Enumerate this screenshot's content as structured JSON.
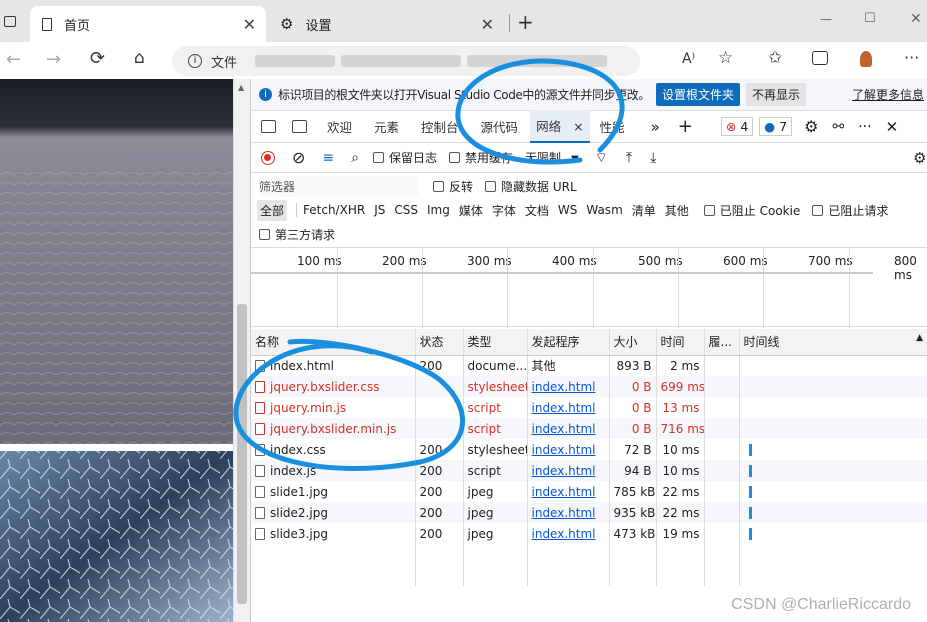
{
  "browser": {
    "tabs": [
      {
        "title": "首页",
        "close": "✕"
      },
      {
        "title": "设置",
        "close": "✕"
      }
    ],
    "new_tab": "+",
    "window_controls": [
      "—",
      "☐",
      "✕"
    ],
    "url_label": "文件",
    "read_aloud": "A⁾"
  },
  "devtools": {
    "infobar": {
      "text": "标识项目的根文件夹以打开Visual Studio Code中的源文件并同步更改。",
      "primary": "设置根文件夹",
      "secondary": "不再显示",
      "more": "了解更多信息"
    },
    "tabs": [
      "欢迎",
      "元素",
      "控制台",
      "源代码",
      "网络",
      "性能"
    ],
    "active_tab_close": "×",
    "error_count": "4",
    "info_count": "7",
    "toolbar": {
      "preserve_log": "保留日志",
      "disable_cache": "禁用缓存",
      "throttle": "无限制"
    },
    "filter": {
      "placeholder": "筛选器",
      "invert": "反转",
      "hide_data_urls": "隐藏数据 URL",
      "types": [
        "全部",
        "Fetch/XHR",
        "JS",
        "CSS",
        "Img",
        "媒体",
        "字体",
        "文档",
        "WS",
        "Wasm",
        "清单",
        "其他"
      ],
      "blocked_cookies": "已阻止 Cookie",
      "blocked_requests": "已阻止请求",
      "third_party": "第三方请求"
    },
    "timeline_ticks": [
      "100 ms",
      "200 ms",
      "300 ms",
      "400 ms",
      "500 ms",
      "600 ms",
      "700 ms",
      "800 ms"
    ],
    "columns": [
      "名称",
      "状态",
      "类型",
      "发起程序",
      "大小",
      "时间",
      "履...",
      "时间线"
    ],
    "rows": [
      {
        "name": "index.html",
        "status": "200",
        "type": "docume...",
        "initiator": "其他",
        "size": "893 B",
        "time": "2 ms",
        "error": false,
        "bar": false
      },
      {
        "name": "jquery.bxslider.css",
        "status": "",
        "type": "stylesheet",
        "initiator": "index.html",
        "size": "0 B",
        "time": "699 ms",
        "error": true,
        "bar": false
      },
      {
        "name": "jquery.min.js",
        "status": "",
        "type": "script",
        "initiator": "index.html",
        "size": "0 B",
        "time": "13 ms",
        "error": true,
        "bar": false
      },
      {
        "name": "jquery.bxslider.min.js",
        "status": "",
        "type": "script",
        "initiator": "index.html",
        "size": "0 B",
        "time": "716 ms",
        "error": true,
        "bar": false
      },
      {
        "name": "index.css",
        "status": "200",
        "type": "stylesheet",
        "initiator": "index.html",
        "size": "72 B",
        "time": "10 ms",
        "error": false,
        "bar": true
      },
      {
        "name": "index.js",
        "status": "200",
        "type": "script",
        "initiator": "index.html",
        "size": "94 B",
        "time": "10 ms",
        "error": false,
        "bar": true
      },
      {
        "name": "slide1.jpg",
        "status": "200",
        "type": "jpeg",
        "initiator": "index.html",
        "size": "785 kB",
        "time": "22 ms",
        "error": false,
        "bar": true
      },
      {
        "name": "slide2.jpg",
        "status": "200",
        "type": "jpeg",
        "initiator": "index.html",
        "size": "935 kB",
        "time": "22 ms",
        "error": false,
        "bar": true
      },
      {
        "name": "slide3.jpg",
        "status": "200",
        "type": "jpeg",
        "initiator": "index.html",
        "size": "473 kB",
        "time": "19 ms",
        "error": false,
        "bar": true
      }
    ]
  },
  "watermark": "CSDN @CharlieRiccardo",
  "colors": {
    "accent": "#0f6cbd",
    "error": "#d93025",
    "link": "#0b57d0",
    "annotation": "#1a8fe0"
  }
}
